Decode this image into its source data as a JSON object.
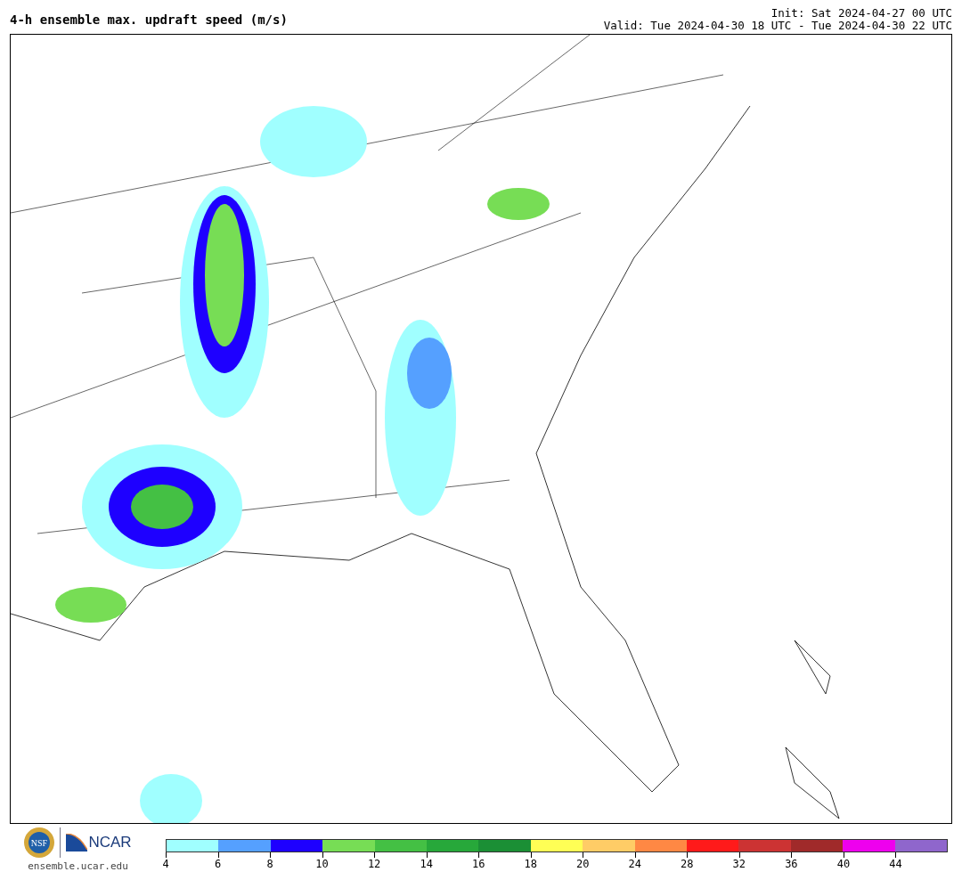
{
  "header": {
    "title": "4-h ensemble max. updraft speed (m/s)",
    "init": "Init: Sat 2024-04-27 00 UTC",
    "valid": "Valid: Tue 2024-04-30 18 UTC - Tue 2024-04-30 22 UTC"
  },
  "footer": {
    "nsf_logo": "NSF",
    "ncar_logo": "NCAR",
    "site": "ensemble.ucar.edu"
  },
  "colorbar": {
    "bins": [
      {
        "color": "#a0ffff"
      },
      {
        "color": "#55a0ff"
      },
      {
        "color": "#1e00ff"
      },
      {
        "color": "#77dd55"
      },
      {
        "color": "#44c044"
      },
      {
        "color": "#27a83a"
      },
      {
        "color": "#1b8f35"
      },
      {
        "color": "#ffff55"
      },
      {
        "color": "#ffcc66"
      },
      {
        "color": "#ff8844"
      },
      {
        "color": "#ff1a1a"
      },
      {
        "color": "#cc3333"
      },
      {
        "color": "#a02a2a"
      },
      {
        "color": "#ee00ee"
      },
      {
        "color": "#8f66cc"
      }
    ],
    "ticks": [
      "4",
      "6",
      "8",
      "10",
      "12",
      "14",
      "16",
      "18",
      "20",
      "24",
      "28",
      "32",
      "36",
      "40",
      "44"
    ]
  }
}
